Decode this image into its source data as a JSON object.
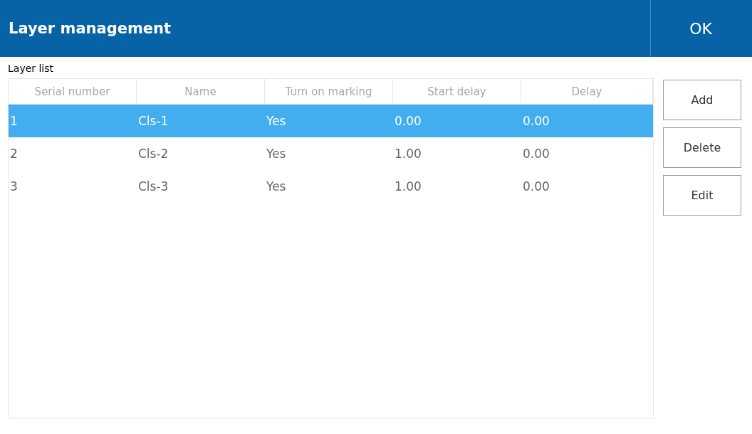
{
  "window": {
    "title": "Layer management",
    "ok_button": "OK"
  },
  "layer_list": {
    "label": "Layer list",
    "columns": [
      "Serial number",
      "Name",
      "Turn on marking",
      "Start delay",
      "Delay"
    ],
    "rows": [
      {
        "cells": [
          "1",
          "Cls-1",
          "Yes",
          "0.00",
          "0.00"
        ],
        "selected": true
      },
      {
        "cells": [
          "2",
          "Cls-2",
          "Yes",
          "1.00",
          "0.00"
        ],
        "selected": false
      },
      {
        "cells": [
          "3",
          "Cls-3",
          "Yes",
          "1.00",
          "0.00"
        ],
        "selected": false
      }
    ]
  },
  "buttons": [
    "Add",
    "Delete",
    "Edit"
  ]
}
